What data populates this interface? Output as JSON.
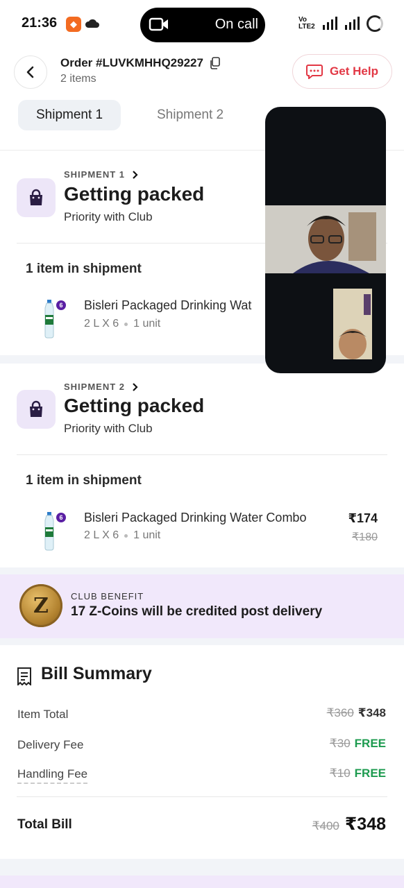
{
  "status_bar": {
    "time": "21:36",
    "call_text": "On call",
    "network_label": "Vo LTE2"
  },
  "header": {
    "order_title": "Order #LUVKMHHQ29227",
    "items_count": "2 items",
    "help_label": "Get Help"
  },
  "tabs": [
    {
      "label": "Shipment 1",
      "active": true
    },
    {
      "label": "Shipment 2",
      "active": false
    }
  ],
  "shipments": [
    {
      "label": "SHIPMENT 1",
      "status": "Getting packed",
      "priority": "Priority with Club",
      "items_heading": "1 item in shipment",
      "product": {
        "badge": "6",
        "name": "Bisleri Packaged Drinking Wat",
        "size": "2 L X 6",
        "qty": "1 unit"
      }
    },
    {
      "label": "SHIPMENT 2",
      "status": "Getting packed",
      "priority": "Priority with Club",
      "items_heading": "1 item in shipment",
      "product": {
        "badge": "6",
        "name": "Bisleri Packaged Drinking Water Combo",
        "size": "2 L X 6",
        "qty": "1 unit",
        "price": "₹174",
        "old_price": "₹180"
      }
    }
  ],
  "club": {
    "coin_letter": "Z",
    "label": "CLUB BENEFIT",
    "text": "17 Z-Coins will be credited post delivery"
  },
  "bill": {
    "title": "Bill Summary",
    "rows": [
      {
        "label": "Item Total",
        "old": "₹360",
        "value": "₹348"
      },
      {
        "label": "Delivery Fee",
        "old": "₹30",
        "value": "FREE"
      },
      {
        "label": "Handling Fee",
        "old": "₹10",
        "value": "FREE"
      }
    ],
    "total_label": "Total Bill",
    "total_old": "₹400",
    "total_value": "₹348"
  },
  "colors": {
    "accent_red": "#e23744",
    "free_green": "#1d9b4f",
    "club_bg": "#f1e8fb",
    "bag_bg": "#ede6f8"
  }
}
